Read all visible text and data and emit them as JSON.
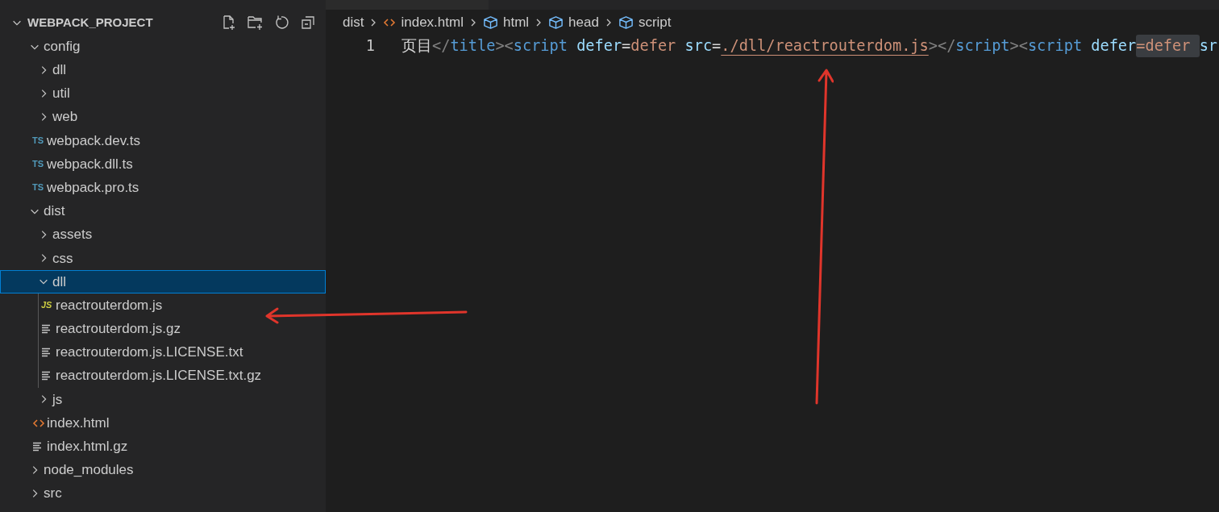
{
  "explorer": {
    "title": "WEBPACK_PROJECT",
    "expanded": true,
    "tree": [
      {
        "label": "config",
        "kind": "folder",
        "expanded": true,
        "selected": false,
        "children": [
          {
            "label": "dll",
            "kind": "folder",
            "expanded": false,
            "selected": false
          },
          {
            "label": "util",
            "kind": "folder",
            "expanded": false,
            "selected": false
          },
          {
            "label": "web",
            "kind": "folder",
            "expanded": false,
            "selected": false
          },
          {
            "label": "webpack.dev.ts",
            "kind": "ts",
            "icon": "TS",
            "selected": false
          },
          {
            "label": "webpack.dll.ts",
            "kind": "ts",
            "icon": "TS",
            "selected": false
          },
          {
            "label": "webpack.pro.ts",
            "kind": "ts",
            "icon": "TS",
            "selected": false
          }
        ]
      },
      {
        "label": "dist",
        "kind": "folder",
        "expanded": true,
        "selected": false,
        "children": [
          {
            "label": "assets",
            "kind": "folder",
            "expanded": false,
            "selected": false
          },
          {
            "label": "css",
            "kind": "folder",
            "expanded": false,
            "selected": false
          },
          {
            "label": "dll",
            "kind": "folder",
            "expanded": true,
            "selected": true,
            "children": [
              {
                "label": "reactrouterdom.js",
                "kind": "js",
                "icon": "JS",
                "selected": false
              },
              {
                "label": "reactrouterdom.js.gz",
                "kind": "file",
                "selected": false
              },
              {
                "label": "reactrouterdom.js.LICENSE.txt",
                "kind": "file",
                "selected": false
              },
              {
                "label": "reactrouterdom.js.LICENSE.txt.gz",
                "kind": "file",
                "selected": false
              }
            ]
          },
          {
            "label": "js",
            "kind": "folder",
            "expanded": false,
            "selected": false
          },
          {
            "label": "index.html",
            "kind": "html",
            "selected": false
          },
          {
            "label": "index.html.gz",
            "kind": "file",
            "selected": false
          }
        ]
      },
      {
        "label": "node_modules",
        "kind": "folder",
        "expanded": false,
        "selected": false
      },
      {
        "label": "src",
        "kind": "folder",
        "expanded": false,
        "selected": false
      }
    ]
  },
  "breadcrumbs": [
    {
      "label": "dist",
      "kind": "folder"
    },
    {
      "label": "index.html",
      "kind": "html"
    },
    {
      "label": "html",
      "kind": "element"
    },
    {
      "label": "head",
      "kind": "element"
    },
    {
      "label": "script",
      "kind": "element"
    }
  ],
  "editor": {
    "lines": [
      {
        "number": "1",
        "tokens": [
          {
            "text": "页目",
            "kind": "text"
          },
          {
            "text": "</",
            "kind": "punct"
          },
          {
            "text": "title",
            "kind": "tag"
          },
          {
            "text": "><",
            "kind": "punct"
          },
          {
            "text": "script",
            "kind": "tag"
          },
          {
            "text": " defer",
            "kind": "attr"
          },
          {
            "text": "=",
            "kind": "text"
          },
          {
            "text": "defer",
            "kind": "value"
          },
          {
            "text": " src",
            "kind": "attr"
          },
          {
            "text": "=",
            "kind": "text"
          },
          {
            "text": "./dll/reactrouterdom.js",
            "kind": "value",
            "underlined": true
          },
          {
            "text": "></",
            "kind": "punct"
          },
          {
            "text": "script",
            "kind": "tag"
          },
          {
            "text": "><",
            "kind": "punct"
          },
          {
            "text": "script",
            "kind": "tag"
          },
          {
            "text": " defer",
            "kind": "attr"
          },
          {
            "text": "=defer ",
            "kind": "value",
            "highlighted": true
          },
          {
            "text": "sr",
            "kind": "attr"
          }
        ]
      }
    ]
  }
}
